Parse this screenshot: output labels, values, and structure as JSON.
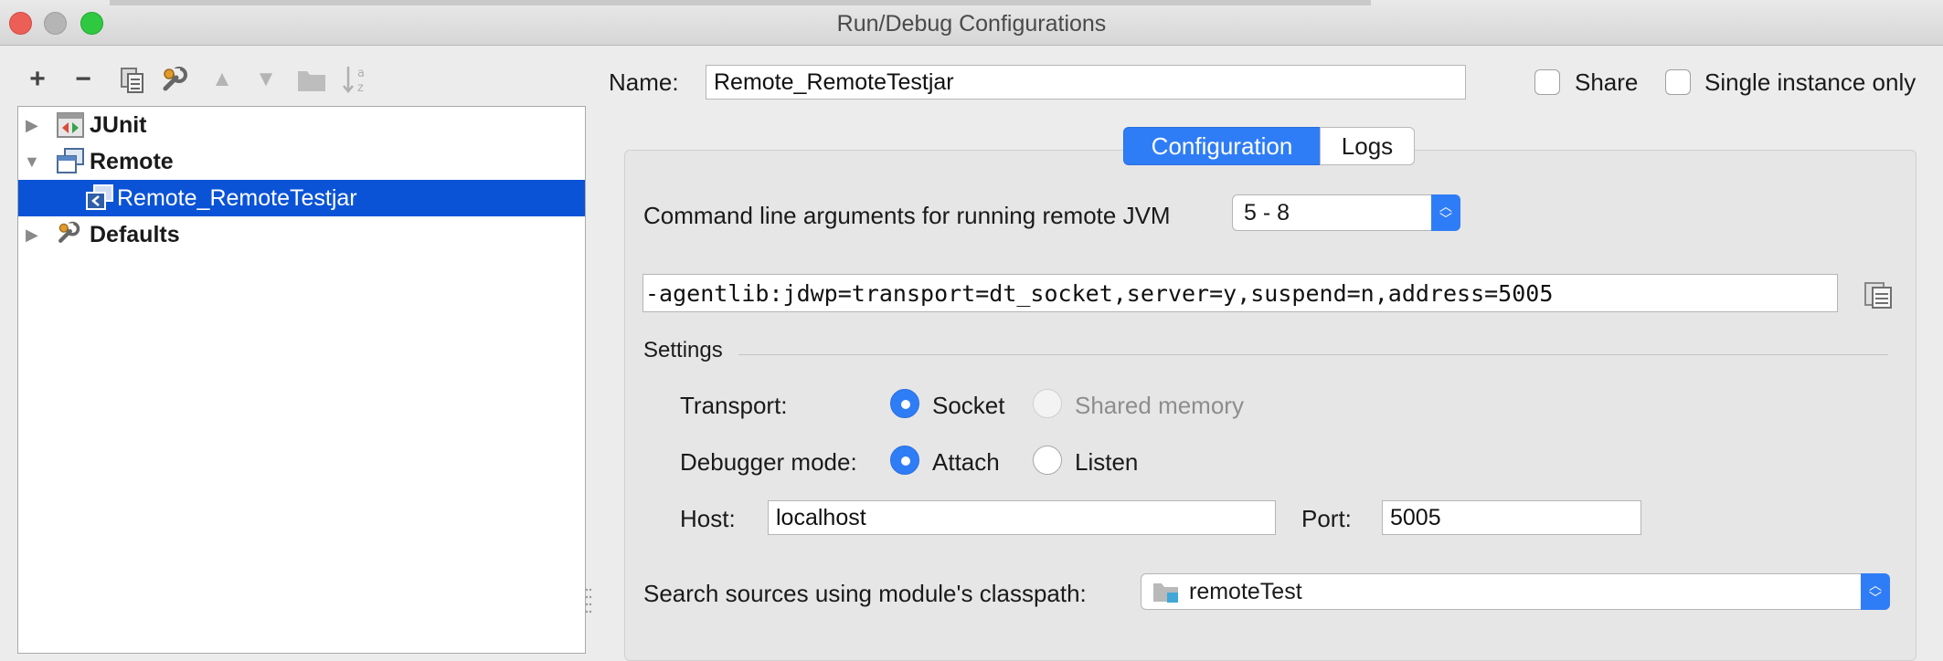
{
  "window": {
    "title": "Run/Debug Configurations"
  },
  "toolbar": {
    "add": "+",
    "remove": "−",
    "sort": "↓a z"
  },
  "tree": {
    "items": [
      {
        "label": "JUnit",
        "icon": "junit-icon",
        "expanded": false
      },
      {
        "label": "Remote",
        "icon": "remote-icon",
        "expanded": true
      },
      {
        "label": "Remote_RemoteTestjar",
        "icon": "remote-config-icon",
        "selected": true
      },
      {
        "label": "Defaults",
        "icon": "wrench-icon",
        "expanded": false
      }
    ]
  },
  "form": {
    "name_label": "Name:",
    "name_value": "Remote_RemoteTestjar",
    "share_label": "Share",
    "share_checked": false,
    "single_instance_label": "Single instance only",
    "single_instance_checked": false
  },
  "tabs": {
    "configuration": "Configuration",
    "logs": "Logs",
    "active": "Configuration"
  },
  "config": {
    "cmdline_label": "Command line arguments for running remote JVM",
    "jvm_version": "5 - 8",
    "cmdline_value": "-agentlib:jdwp=transport=dt_socket,server=y,suspend=n,address=5005",
    "settings_label": "Settings",
    "transport_label": "Transport:",
    "transport_socket": "Socket",
    "transport_shared": "Shared memory",
    "debugger_label": "Debugger mode:",
    "debugger_attach": "Attach",
    "debugger_listen": "Listen",
    "host_label": "Host:",
    "host_value": "localhost",
    "port_label": "Port:",
    "port_value": "5005",
    "classpath_label": "Search sources using module's classpath:",
    "classpath_module": "remoteTest"
  },
  "colors": {
    "selection": "#0b53d6",
    "accent": "#2f7df6",
    "close": "#ec5f57",
    "maximize": "#2ec941"
  }
}
